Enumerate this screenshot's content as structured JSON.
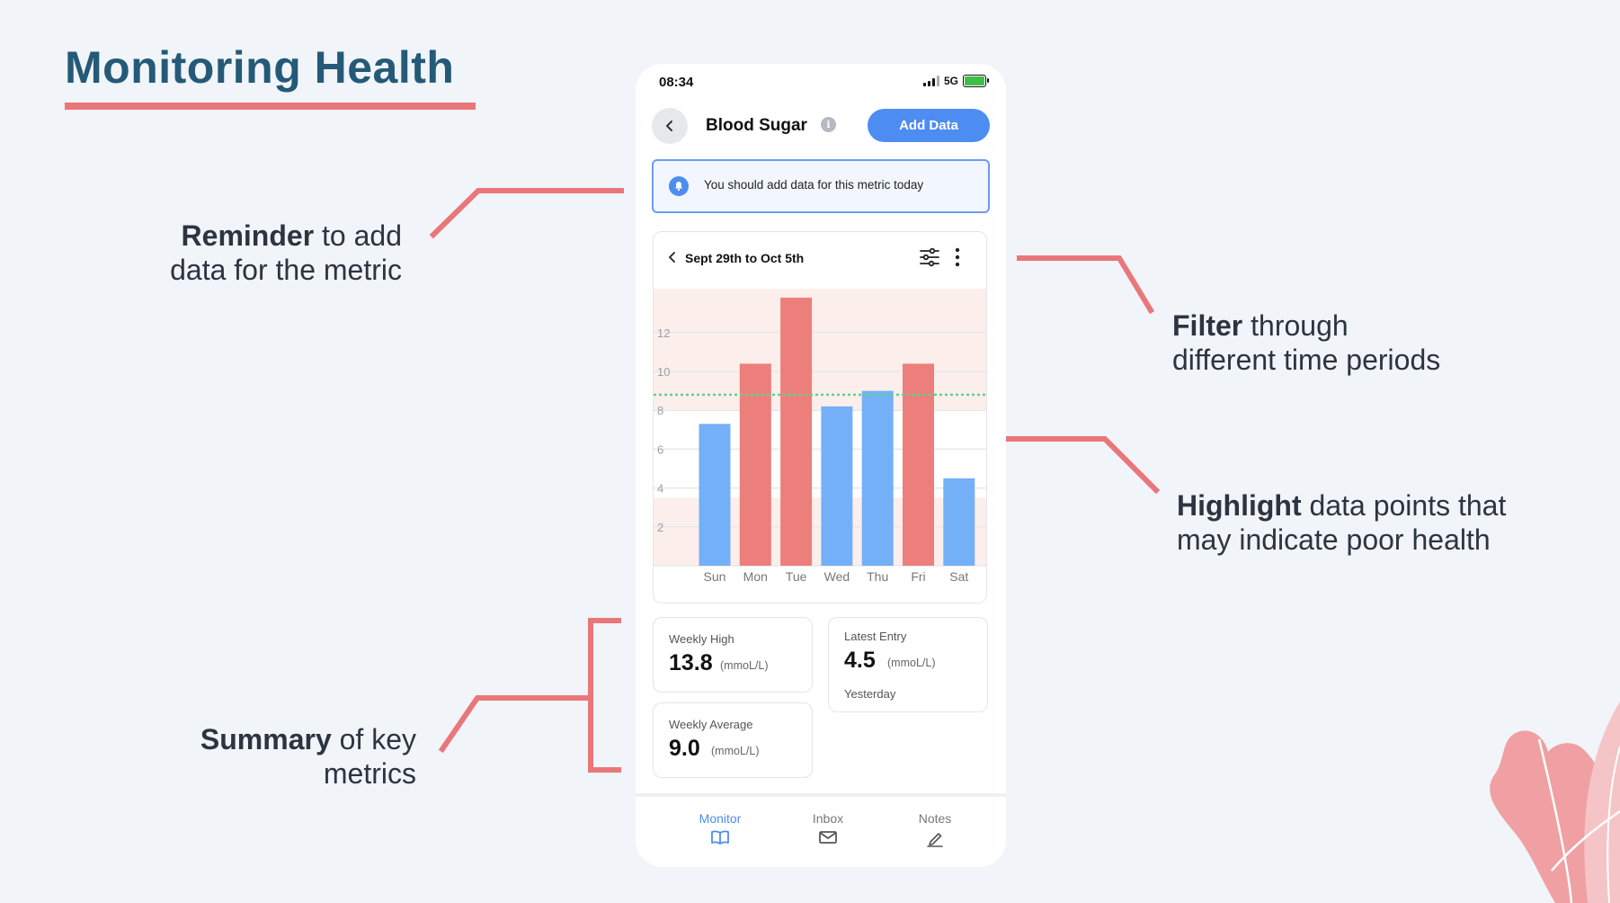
{
  "slide": {
    "title": "Monitoring Health",
    "accent_color": "#e9777a",
    "title_color": "#245a78"
  },
  "callouts": {
    "reminder": {
      "bold": "Reminder",
      "rest": " to add",
      "line2": "data for the metric"
    },
    "filter": {
      "bold": "Filter",
      "rest": " through",
      "line2": "different time periods"
    },
    "highlight": {
      "bold": "Highlight",
      "rest": " data points that",
      "line2": "may indicate poor health"
    },
    "summary": {
      "bold": "Summary",
      "rest": " of key",
      "line2": "metrics"
    }
  },
  "phone": {
    "status": {
      "time": "08:34",
      "network": "5G"
    },
    "header": {
      "title": "Blood Sugar",
      "info_glyph": "i",
      "add_button": "Add Data"
    },
    "reminder": {
      "text": "You should add data for this metric today"
    },
    "chart_header": {
      "date_range": "Sept 29th to Oct 5th"
    },
    "stats": {
      "weekly_high": {
        "label": "Weekly High",
        "value": "13.8",
        "unit": "(mmoL/L)"
      },
      "latest_entry": {
        "label": "Latest Entry",
        "value": "4.5",
        "unit": "(mmoL/L)",
        "sub": "Yesterday"
      },
      "weekly_average": {
        "label": "Weekly Average",
        "value": "9.0",
        "unit": "(mmoL/L)"
      }
    },
    "tabs": [
      {
        "label": "Monitor",
        "icon": "book-icon",
        "active": true
      },
      {
        "label": "Inbox",
        "icon": "envelope-icon",
        "active": false
      },
      {
        "label": "Notes",
        "icon": "pencil-icon",
        "active": false
      }
    ]
  },
  "chart_data": {
    "type": "bar",
    "categories": [
      "Sun",
      "Mon",
      "Tue",
      "Wed",
      "Thu",
      "Fri",
      "Sat"
    ],
    "values": [
      7.3,
      10.4,
      13.8,
      8.2,
      9.0,
      10.4,
      4.5
    ],
    "highlighted": [
      false,
      true,
      true,
      false,
      false,
      true,
      false
    ],
    "y_ticks": [
      2,
      4,
      6,
      8,
      10,
      12
    ],
    "ylim": [
      0,
      14
    ],
    "threshold": 8.8,
    "grid": true,
    "colors": {
      "normal": "#74b0f7",
      "highlight": "#ec7f7c",
      "threshold": "#58d68d",
      "band": "#fcefeb"
    }
  }
}
